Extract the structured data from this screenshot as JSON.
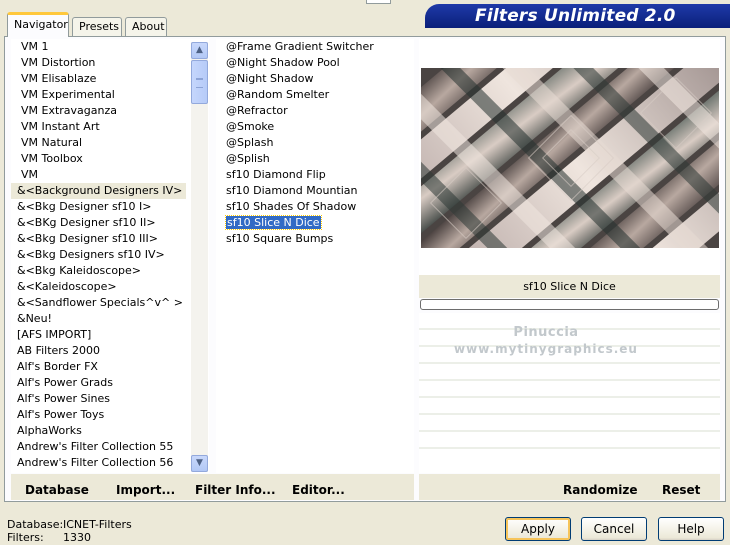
{
  "window": {
    "brand_title": "Filters Unlimited 2.0"
  },
  "tabs": [
    {
      "label": "Navigator",
      "active": true
    },
    {
      "label": "Presets",
      "active": false
    },
    {
      "label": "About",
      "active": false
    }
  ],
  "categories": {
    "items": [
      "VM 1",
      "VM Distortion",
      "VM Elisablaze",
      "VM Experimental",
      "VM Extravaganza",
      "VM Instant Art",
      "VM Natural",
      "VM Toolbox",
      "VM",
      "&<Background Designers IV>",
      "&<Bkg Designer sf10 I>",
      "&<BKg Designer sf10 II>",
      "&<Bkg Designer sf10 III>",
      "&<Bkg Designers sf10 IV>",
      "&<Bkg Kaleidoscope>",
      "&<Kaleidoscope>",
      "&<Sandflower Specials^v^ >",
      "&Neu!",
      "[AFS IMPORT]",
      "AB Filters 2000",
      "Alf's Border FX",
      "Alf's Power Grads",
      "Alf's Power Sines",
      "Alf's Power Toys",
      "AlphaWorks",
      "Andrew's Filter Collection 55",
      "Andrew's Filter Collection 56"
    ],
    "selected_index": 9
  },
  "filters": {
    "items": [
      "@Frame Gradient Switcher",
      "@Night Shadow Pool",
      "@Night Shadow",
      "@Random Smelter",
      "@Refractor",
      "@Smoke",
      "@Splash",
      "@Splish",
      "sf10 Diamond Flip",
      "sf10 Diamond Mountian",
      "sf10 Shades Of Shadow",
      "sf10 Slice N Dice",
      "sf10 Square Bumps"
    ],
    "selected_index": 11
  },
  "preview": {
    "filter_name": "sf10 Slice N Dice",
    "progress": 0,
    "watermark_line1": "Pinuccia",
    "watermark_line2": "www.mytinygraphics.eu"
  },
  "left_buttons": {
    "database": "Database",
    "import": "Import...",
    "filter_info": "Filter Info...",
    "editor": "Editor..."
  },
  "right_buttons": {
    "randomize": "Randomize",
    "reset": "Reset"
  },
  "status": {
    "database_label": "Database:",
    "database_value": "ICNET-Filters",
    "filters_label": "Filters:",
    "filters_value": "1330"
  },
  "dialog_buttons": {
    "apply": "Apply",
    "cancel": "Cancel",
    "help": "Help"
  },
  "colors": {
    "brand_blue": "#0a1f7a",
    "selection_blue": "#316ac5",
    "active_tab_accent": "#ffc83c",
    "window_bg": "#ece9d8"
  },
  "icons": {
    "scroll_up": "scroll-up-arrow-icon",
    "scroll_down": "scroll-down-arrow-icon"
  }
}
